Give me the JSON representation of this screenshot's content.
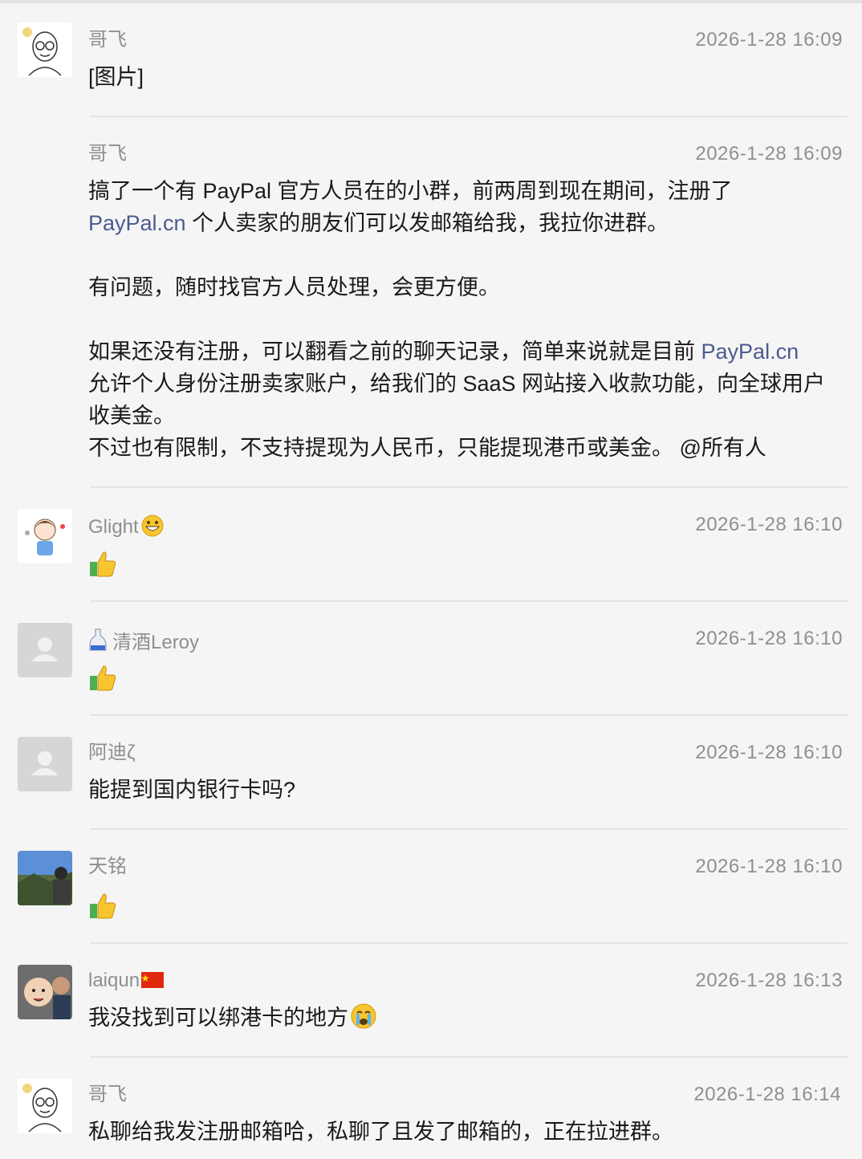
{
  "messages": [
    {
      "name": "哥飞",
      "time": "2026-1-28 16:09",
      "text": "[图片]",
      "avatar": "cartoon-glasses-avatar"
    },
    {
      "name": "哥飞",
      "time": "2026-1-28 16:09",
      "p1a": "搞了一个有 PayPal 官方人员在的小群，前两周到现在期间，注册了",
      "p1link": "PayPal.cn",
      "p1b": " 个人卖家的朋友们可以发邮箱给我，我拉你进群。",
      "p2": "有问题，随时找官方人员处理，会更方便。",
      "p3a": "如果还没有注册，可以翻看之前的聊天记录，简单来说就是目前 ",
      "p3link": "PayPal.cn",
      "p3b": "允许个人身份注册卖家账户，给我们的 SaaS 网站接入收款功能，向全球用户收美金。",
      "p4": "不过也有限制，不支持提现为人民币，只能提现港币或美金。 @所有人"
    },
    {
      "name": "Glight",
      "time": "2026-1-28 16:10",
      "name_emoji": "grinning-face-emoji",
      "content": "thumbs-up-icon"
    },
    {
      "name": "清酒Leroy",
      "time": "2026-1-28 16:10",
      "name_emoji": "sake-bottle-emoji",
      "content": "thumbs-up-icon"
    },
    {
      "name": "阿迪ζ",
      "time": "2026-1-28 16:10",
      "text": "能提到国内银行卡吗?"
    },
    {
      "name": "天铭",
      "time": "2026-1-28 16:10",
      "content": "thumbs-up-icon"
    },
    {
      "name": "laiqun",
      "time": "2026-1-28 16:13",
      "name_emoji": "china-flag-emoji",
      "text": "我没找到可以绑港卡的地方",
      "text_emoji": "crying-face-emoji"
    },
    {
      "name": "哥飞",
      "time": "2026-1-28 16:14",
      "text": "私聊给我发注册邮箱哈，私聊了且发了邮箱的，正在拉进群。"
    }
  ],
  "colors": {
    "background": "#f5f5f5",
    "name": "#8f8f8f",
    "link": "#4b5b8f",
    "separator": "#e4e4e4"
  }
}
